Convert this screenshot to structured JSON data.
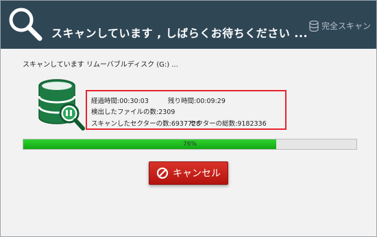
{
  "header": {
    "title": "スキャンしています , しばらくお待ちください ...",
    "full_scan_label": "完全スキャン",
    "icons": {
      "search": "search-icon",
      "full_scan": "database-icon"
    },
    "colors": {
      "background": "#2f4655",
      "text": "#ffffff"
    }
  },
  "scan": {
    "target_text": "スキャンしています リムーバブルディスク (G:) ...",
    "elapsed_label": "経過時間:",
    "elapsed_value": "00:30:03",
    "remaining_label": "残り時間:",
    "remaining_value": "00:09:29",
    "files_found_label": "検出したファイルの数:",
    "files_found_value": "2309",
    "sectors_scanned_label": "スキャンしたセクターの数:",
    "sectors_scanned_value": "6937728",
    "sectors_total_label": "セクターの総数:",
    "sectors_total_value": "9182336"
  },
  "progress": {
    "percent_text": "76%",
    "fraction": 0.76,
    "color": "#1fbd1f"
  },
  "cancel_button": {
    "label": "キャンセル",
    "icon": "ban-icon",
    "color": "#c8211a"
  },
  "highlight_color": "#e8212b"
}
